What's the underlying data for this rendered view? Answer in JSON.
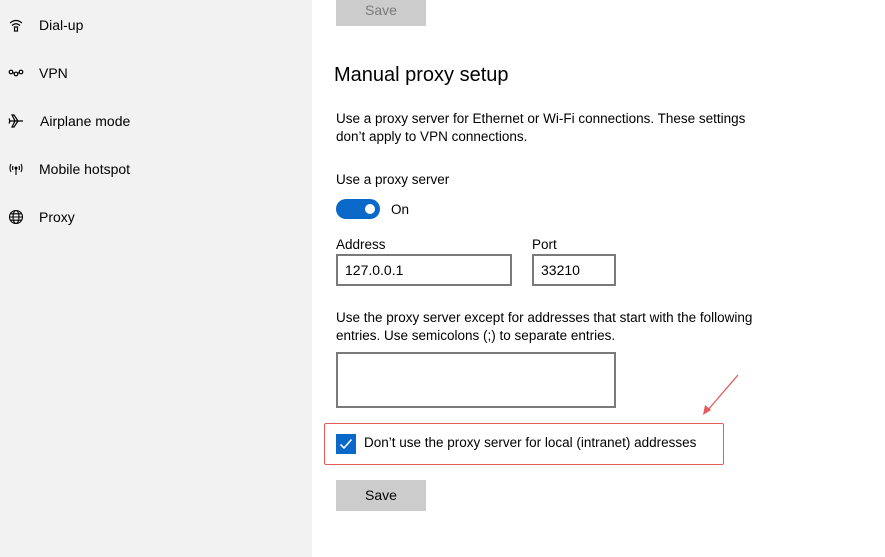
{
  "sidebar": {
    "items": [
      {
        "label": "Dial-up",
        "icon": "dial-up-icon"
      },
      {
        "label": "VPN",
        "icon": "vpn-icon"
      },
      {
        "label": "Airplane mode",
        "icon": "airplane-icon"
      },
      {
        "label": "Mobile hotspot",
        "icon": "mobile-hotspot-icon"
      },
      {
        "label": "Proxy",
        "icon": "globe-icon"
      }
    ]
  },
  "main": {
    "top_save_label": "Save",
    "section_title": "Manual proxy setup",
    "description": "Use a proxy server for Ethernet or Wi-Fi connections. These settings don’t apply to VPN connections.",
    "use_proxy_label": "Use a proxy server",
    "toggle_state": "On",
    "address_label": "Address",
    "address_value": "127.0.0.1",
    "port_label": "Port",
    "port_value": "33210",
    "exceptions_text": "Use the proxy server except for addresses that start with the following entries. Use semicolons (;) to separate entries.",
    "exceptions_value": "",
    "local_checkbox_label": "Don’t use the proxy server for local (intranet) addresses",
    "local_checkbox_checked": true,
    "save_label": "Save"
  },
  "colors": {
    "accent": "#0a68c8",
    "annotation": "#e45b5b",
    "sidebar_bg": "#f2f2f2",
    "button_bg": "#cccccc"
  }
}
